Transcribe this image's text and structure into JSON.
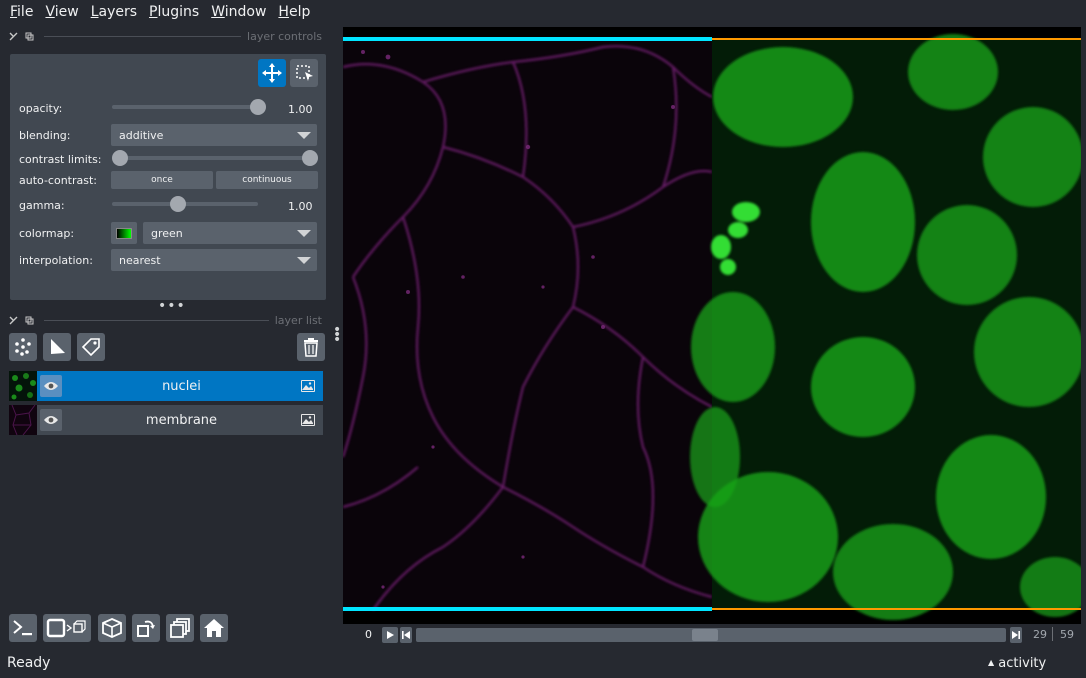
{
  "menu": [
    {
      "label": "File",
      "mnemonic": "F",
      "rest": "ile"
    },
    {
      "label": "View",
      "mnemonic": "V",
      "rest": "iew"
    },
    {
      "label": "Layers",
      "mnemonic": "L",
      "rest": "ayers"
    },
    {
      "label": "Plugins",
      "mnemonic": "P",
      "rest": "lugins"
    },
    {
      "label": "Window",
      "mnemonic": "W",
      "rest": "indow"
    },
    {
      "label": "Help",
      "mnemonic": "H",
      "rest": "elp"
    }
  ],
  "layer_controls": {
    "title": "layer controls",
    "opacity_label": "opacity:",
    "opacity_value": "1.00",
    "opacity_fraction": 1.0,
    "blending_label": "blending:",
    "blending_value": "additive",
    "contrast_label": "contrast limits:",
    "contrast_range": [
      0.0,
      1.0
    ],
    "auto_contrast_label": "auto-contrast:",
    "once_label": "once",
    "continuous_label": "continuous",
    "gamma_label": "gamma:",
    "gamma_value": "1.00",
    "gamma_fraction": 0.45,
    "colormap_label": "colormap:",
    "colormap_value": "green",
    "interpolation_label": "interpolation:",
    "interpolation_value": "nearest"
  },
  "layer_list": {
    "title": "layer list",
    "layers": [
      {
        "name": "nuclei",
        "selected": true
      },
      {
        "name": "membrane",
        "selected": false
      }
    ]
  },
  "dims": {
    "current_start": "0",
    "current_value": "29",
    "max_value": "59",
    "slider_fraction": 0.49
  },
  "status": {
    "text": "Ready",
    "activity_label": "activity"
  },
  "colors": {
    "background": "#262930",
    "panel": "#414851",
    "accent": "#0076c3",
    "membrane": "#8a2a8a",
    "nuclei": "#1fa81f",
    "left_border": "#00e5ff",
    "right_border": "#ff9900"
  }
}
